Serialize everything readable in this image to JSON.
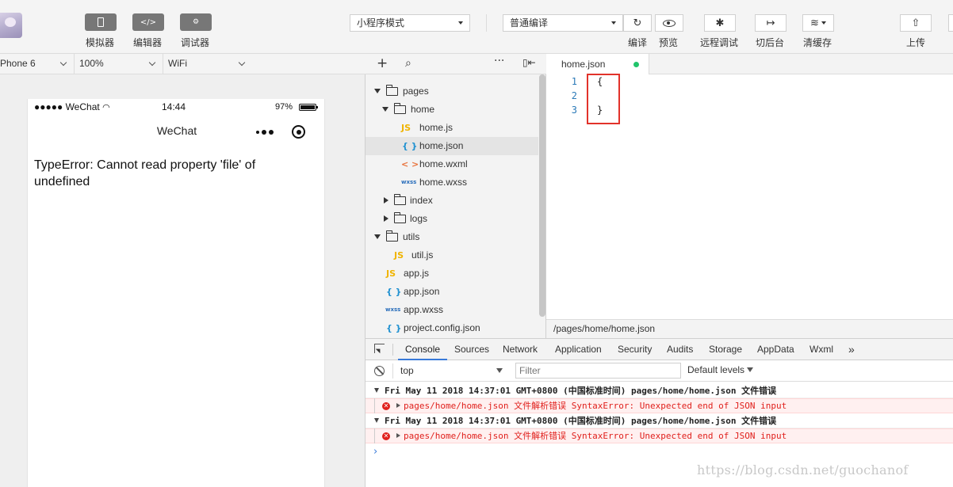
{
  "toolbar": {
    "simulator_label": "模拟器",
    "editor_label": "编辑器",
    "debugger_label": "调试器",
    "editor_icon": "</>",
    "mode_select": "小程序模式",
    "compile_select": "普通编译",
    "compile_label": "编译",
    "preview_label": "预览",
    "remote_debug_label": "远程调试",
    "background_label": "切后台",
    "clear_cache_label": "清缓存",
    "upload_label": "上传"
  },
  "devicebar": {
    "device": "Phone 6",
    "zoom": "100%",
    "network": "WiFi"
  },
  "phone": {
    "signal": "●●●●● WeChat",
    "time": "14:44",
    "battery": "97%",
    "nav_title": "WeChat",
    "error_message": "TypeError: Cannot read property 'file' of undefined"
  },
  "tree": {
    "items": [
      {
        "label": "pages"
      },
      {
        "label": "home"
      },
      {
        "label": "home.js"
      },
      {
        "label": "home.json"
      },
      {
        "label": "home.wxml"
      },
      {
        "label": "home.wxss"
      },
      {
        "label": "index"
      },
      {
        "label": "logs"
      },
      {
        "label": "utils"
      },
      {
        "label": "util.js"
      },
      {
        "label": "app.js"
      },
      {
        "label": "app.json"
      },
      {
        "label": "app.wxss"
      },
      {
        "label": "project.config.json"
      }
    ],
    "icons": {
      "js": "JS",
      "json": "{ }",
      "wxml": "< >",
      "wxss": "wxss"
    }
  },
  "editor": {
    "tab_label": "home.json",
    "lines": [
      {
        "num": "1",
        "code": "{"
      },
      {
        "num": "2",
        "code": ""
      },
      {
        "num": "3",
        "code": "}"
      }
    ],
    "path": "/pages/home/home.json"
  },
  "devtools": {
    "tabs": [
      "Console",
      "Sources",
      "Network",
      "Application",
      "Security",
      "Audits",
      "Storage",
      "AppData",
      "Wxml",
      "»"
    ],
    "context": "top",
    "filter_placeholder": "Filter",
    "levels": "Default levels",
    "logs": [
      {
        "group": "Fri May 11 2018 14:37:01 GMT+0800 (中国标准时间) pages/home/home.json 文件错误",
        "error": "pages/home/home.json 文件解析错误  SyntaxError: Unexpected end of JSON input"
      },
      {
        "group": "Fri May 11 2018 14:37:01 GMT+0800 (中国标准时间) pages/home/home.json 文件错误",
        "error": "pages/home/home.json 文件解析错误  SyntaxError: Unexpected end of JSON input"
      }
    ],
    "prompt": "›"
  },
  "watermark": "https://blog.csdn.net/guochanof",
  "colors": {
    "accent": "#3879d9",
    "error": "#e0201c",
    "highlight": "#e2322a",
    "modified_dot": "#21c46b"
  }
}
